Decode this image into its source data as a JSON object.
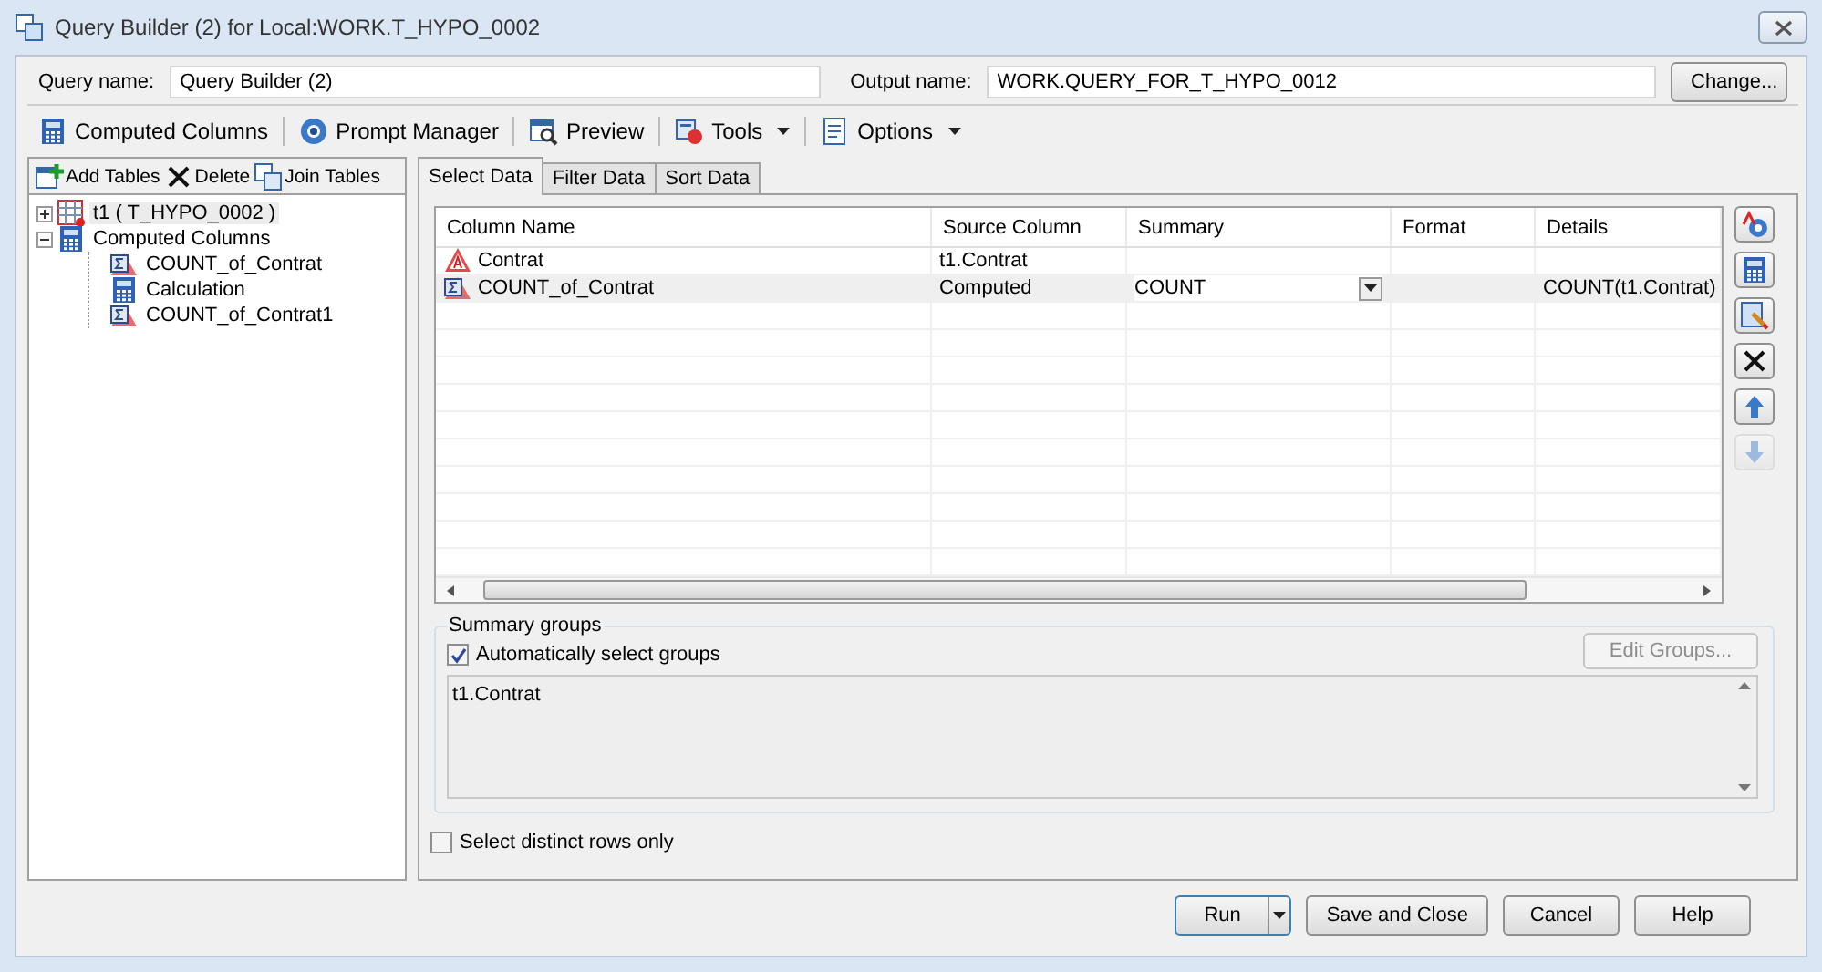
{
  "window": {
    "title": "Query Builder (2) for Local:WORK.T_HYPO_0002"
  },
  "query_name": {
    "label": "Query name:",
    "value": "Query Builder (2)"
  },
  "output_name": {
    "label": "Output name:",
    "value": "WORK.QUERY_FOR_T_HYPO_0012"
  },
  "change_button": "Change...",
  "toolbar": [
    {
      "kind": "calc",
      "label": "Computed Columns",
      "menu": false
    },
    {
      "kind": "prompt",
      "label": "Prompt Manager",
      "menu": false
    },
    {
      "kind": "preview",
      "label": "Preview",
      "menu": false
    },
    {
      "kind": "tools",
      "label": "Tools",
      "menu": true
    },
    {
      "kind": "options",
      "label": "Options",
      "menu": true
    }
  ],
  "left_toolbar": [
    {
      "kind": "add",
      "label": "Add Tables"
    },
    {
      "kind": "delete",
      "label": "Delete"
    },
    {
      "kind": "join",
      "label": "Join Tables"
    }
  ],
  "tree": [
    {
      "kind": "table",
      "label": "t1 ( T_HYPO_0002 )",
      "expanded": false,
      "selected": true
    },
    {
      "kind": "calc",
      "label": "Computed Columns",
      "expanded": true,
      "selected": false,
      "children": [
        {
          "kind": "sigma",
          "label": "COUNT_of_Contrat",
          "selected": false
        },
        {
          "kind": "calc",
          "label": "Calculation",
          "selected": false
        },
        {
          "kind": "sigma",
          "label": "COUNT_of_Contrat1",
          "selected": false
        }
      ]
    }
  ],
  "tabs": [
    {
      "label": "Select Data",
      "selected": true
    },
    {
      "label": "Filter Data",
      "selected": false
    },
    {
      "label": "Sort Data",
      "selected": false
    }
  ],
  "table": {
    "columns": [
      "Column Name",
      "Source Column",
      "Summary",
      "Format",
      "Details"
    ],
    "rows": [
      {
        "kind": "char",
        "cells": [
          "Contrat",
          "t1.Contrat",
          "",
          "",
          ""
        ],
        "selected": false,
        "dropdown": false
      },
      {
        "kind": "sigma",
        "cells": [
          "COUNT_of_Contrat",
          "Computed",
          "COUNT",
          "",
          "COUNT(t1.Contrat)"
        ],
        "selected": true,
        "dropdown": true
      }
    ]
  },
  "side_buttons": [
    {
      "kind": "props",
      "disabled": false
    },
    {
      "kind": "calc",
      "disabled": false
    },
    {
      "kind": "edit",
      "disabled": false
    },
    {
      "kind": "delete",
      "disabled": false
    },
    {
      "kind": "up",
      "disabled": false
    },
    {
      "kind": "down",
      "disabled": true
    }
  ],
  "summary_groups": {
    "title": "Summary groups",
    "auto_select": {
      "label": "Automatically select groups",
      "checked": true
    },
    "edit_button": {
      "label": "Edit Groups...",
      "disabled": true
    },
    "items": [
      "t1.Contrat"
    ]
  },
  "distinct": {
    "label": "Select distinct rows only",
    "checked": false
  },
  "buttons": [
    {
      "label": "Run",
      "split": true,
      "default": true
    },
    {
      "label": "Save and Close",
      "split": false,
      "default": false
    },
    {
      "label": "Cancel",
      "split": false,
      "default": false
    },
    {
      "label": "Help",
      "split": false,
      "default": false
    }
  ]
}
